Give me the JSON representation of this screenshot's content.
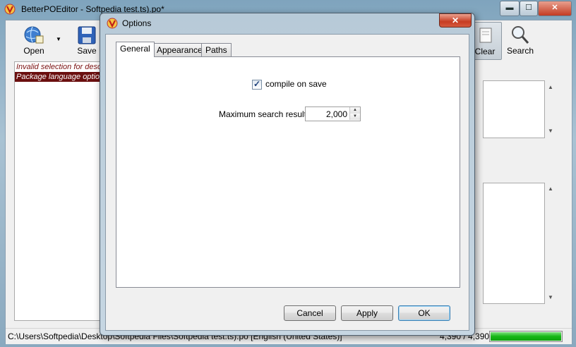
{
  "main_window": {
    "title": "BetterPOEditor - Softpedia test.ts).po*",
    "controls": {
      "minimize": "▬",
      "maximize": "☐",
      "close": "✕"
    },
    "toolbar": [
      {
        "label": "Open",
        "icon": "globe-folder-icon"
      },
      {
        "label": "Save",
        "icon": "floppy-disk-icon"
      },
      {
        "label": "Clear",
        "icon": "clear-icon"
      },
      {
        "label": "Search",
        "icon": "magnifier-icon"
      }
    ],
    "messages": [
      "Invalid selection for desc",
      "Package language optio"
    ],
    "status": {
      "path": "C:\\Users\\Softpedia\\Desktop\\Softpedia Files\\Softpedia test.ts).po [English (United States)]",
      "count": "4,390 / 4,390",
      "progress": 1.0
    }
  },
  "dialog": {
    "title": "Options",
    "close": "✕",
    "tabs": [
      "General",
      "Appearance",
      "Paths"
    ],
    "active_tab": "General",
    "compile_on_save": {
      "label": "compile on save",
      "checked": true
    },
    "max_search": {
      "label": "Maximum search results",
      "value": "2,000"
    },
    "buttons": {
      "cancel": "Cancel",
      "apply": "Apply",
      "ok": "OK"
    }
  },
  "colors": {
    "accent": "#3c7fb1",
    "message_selected": "#6b0f0f",
    "progress": "#16b716"
  }
}
